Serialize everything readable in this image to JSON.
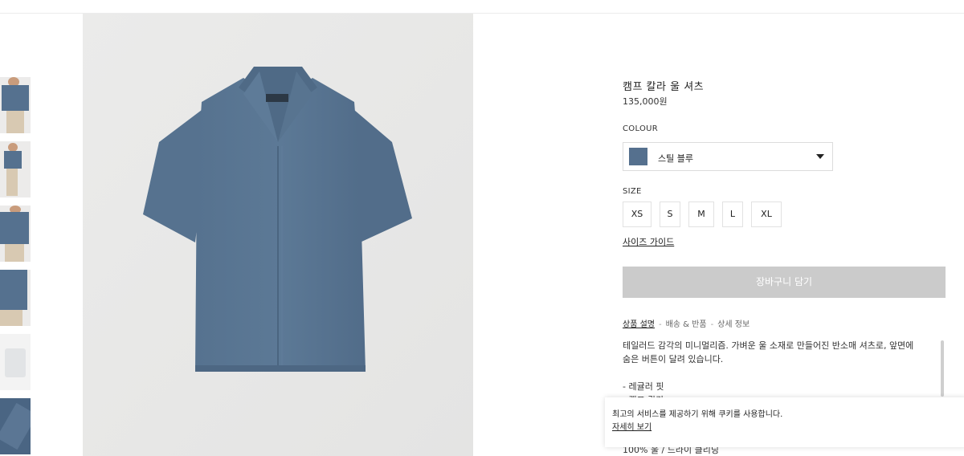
{
  "product": {
    "title": "캠프 칼라 울 셔츠",
    "price": "135,000원"
  },
  "colour": {
    "label": "COLOUR",
    "selected": "스틸 블루",
    "swatch_color": "#55708e"
  },
  "size": {
    "label": "SIZE",
    "options": [
      "XS",
      "S",
      "M",
      "L",
      "XL"
    ],
    "guide_label": "사이즈 가이드"
  },
  "cart": {
    "button_label": "장바구니 담기"
  },
  "tabs": {
    "items": [
      "상품 설명",
      "배송 & 반품",
      "상세 정보"
    ],
    "separator": "-"
  },
  "description": {
    "lines": [
      "테일러드 감각의 미니멀리즘. 가벼운 울 소재로 만들어진 반소매 셔츠로, 앞면에",
      "숨은 버튼이 달려 있습니다.",
      "",
      "- 레귤러 핏",
      "- 캠프 칼라"
    ],
    "fabric_line": "100% 울 / 드라이 클리닝"
  },
  "cookie": {
    "text": "최고의 서비스를 제공하기 위해 쿠키를 사용합니다.",
    "link": "자세히 보기"
  },
  "icons": {
    "dropdown": "chevron-down-icon"
  }
}
